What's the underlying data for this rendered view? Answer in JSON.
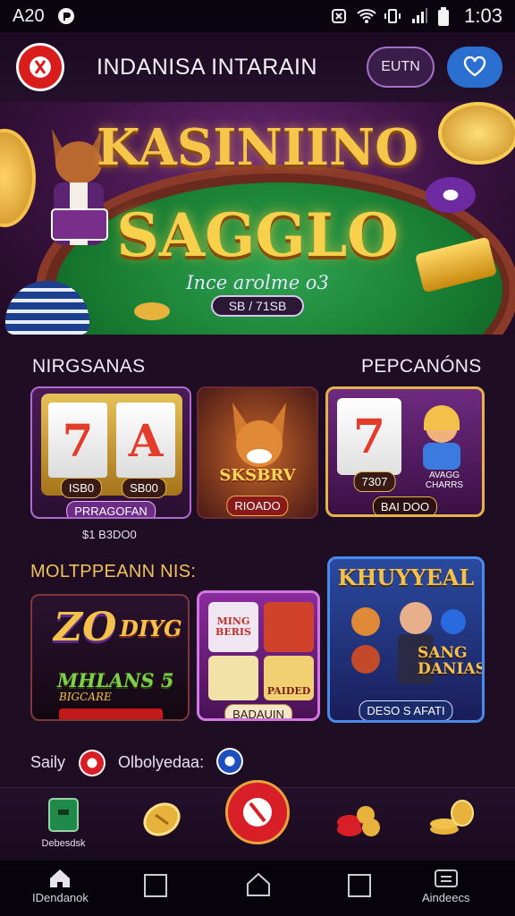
{
  "status_bar": {
    "carrier": "A20",
    "time": "1:03"
  },
  "header": {
    "title": "INDANISA INTARAIN",
    "login_label": "EUTN",
    "fav_icon": "heart-icon"
  },
  "hero": {
    "title_line1": "KASINIINO",
    "title_line2": "SAGGLO",
    "subtitle": "Ince arolme o3",
    "pill": "SB / 71SB"
  },
  "sections": {
    "left_label": "NIRGSANAS",
    "right_label": "PEPCANÓNS",
    "row2_label": "MOLTPPEANN NIS:",
    "row2_right_label": "KHUYYEAL"
  },
  "row1": [
    {
      "reel_left": "7",
      "reel_right": "A",
      "val_left": "ISB0",
      "val_right": "SB00",
      "caption": "PRRAGOFAN",
      "below": "$1 B3DO0"
    },
    {
      "title": "SKSBRV",
      "caption": "RIOADO"
    },
    {
      "value": "7307",
      "side_text": "AVAGG CHARRS",
      "caption": "BAI DOO"
    }
  ],
  "row2": [
    {
      "big": "ZO",
      "tag": "DIYG",
      "sub1": "MHLANS 5",
      "sub2": "BIGCARE"
    },
    {
      "top_left": "MING BERIS",
      "bottom_right": "PAIDED",
      "caption": "BADAUIN"
    },
    {
      "text": "SANG DANIAS",
      "caption": "DESO S AFATI"
    }
  ],
  "footer_row": {
    "left": "Saily",
    "right": "Olbolyedaa:"
  },
  "bottom_nav": {
    "first_label": "Debesdsk"
  },
  "system_nav": {
    "left_label": "IDendanok",
    "right_label": "Aindeecs"
  },
  "colors": {
    "background": "#1e0d23",
    "accent_blue": "#2b6fd1",
    "gold": "#f6c64a"
  }
}
